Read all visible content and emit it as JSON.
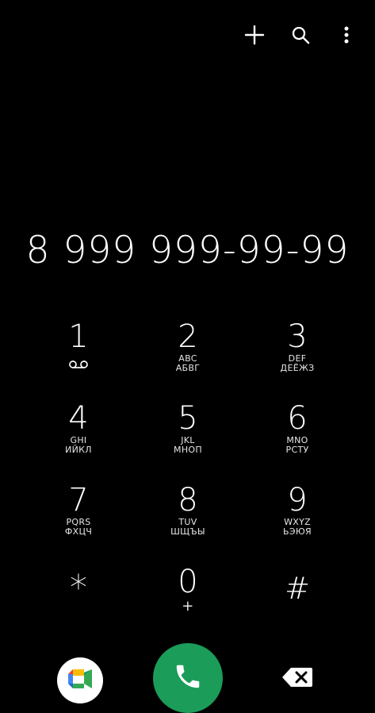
{
  "toolbar": {
    "add_icon": "plus-icon",
    "search_icon": "search-icon",
    "more_icon": "more-vertical-icon"
  },
  "dialed_number": "8 999 999-99-99",
  "keys": [
    {
      "digit": "1",
      "sub1": "",
      "sub2": "",
      "icon": "voicemail-icon"
    },
    {
      "digit": "2",
      "sub1": "ABC",
      "sub2": "АБВГ"
    },
    {
      "digit": "3",
      "sub1": "DEF",
      "sub2": "ДЕЁЖЗ"
    },
    {
      "digit": "4",
      "sub1": "GHI",
      "sub2": "ИЙКЛ"
    },
    {
      "digit": "5",
      "sub1": "JKL",
      "sub2": "МНОП"
    },
    {
      "digit": "6",
      "sub1": "MNO",
      "sub2": "РСТУ"
    },
    {
      "digit": "7",
      "sub1": "PQRS",
      "sub2": "ФХЦЧ"
    },
    {
      "digit": "8",
      "sub1": "TUV",
      "sub2": "ШЩЪЫ"
    },
    {
      "digit": "9",
      "sub1": "WXYZ",
      "sub2": "ЬЭЮЯ"
    },
    {
      "digit": "*",
      "sub1": "",
      "sub2": ""
    },
    {
      "digit": "0",
      "sub1": "+",
      "sub2": ""
    },
    {
      "digit": "#",
      "sub1": "",
      "sub2": ""
    }
  ],
  "actions": {
    "video_call_icon": "google-meet-icon",
    "call_icon": "phone-icon",
    "backspace_icon": "backspace-icon"
  },
  "colors": {
    "background": "#000000",
    "call_button": "#1b9c59",
    "text": "#ffffff"
  }
}
